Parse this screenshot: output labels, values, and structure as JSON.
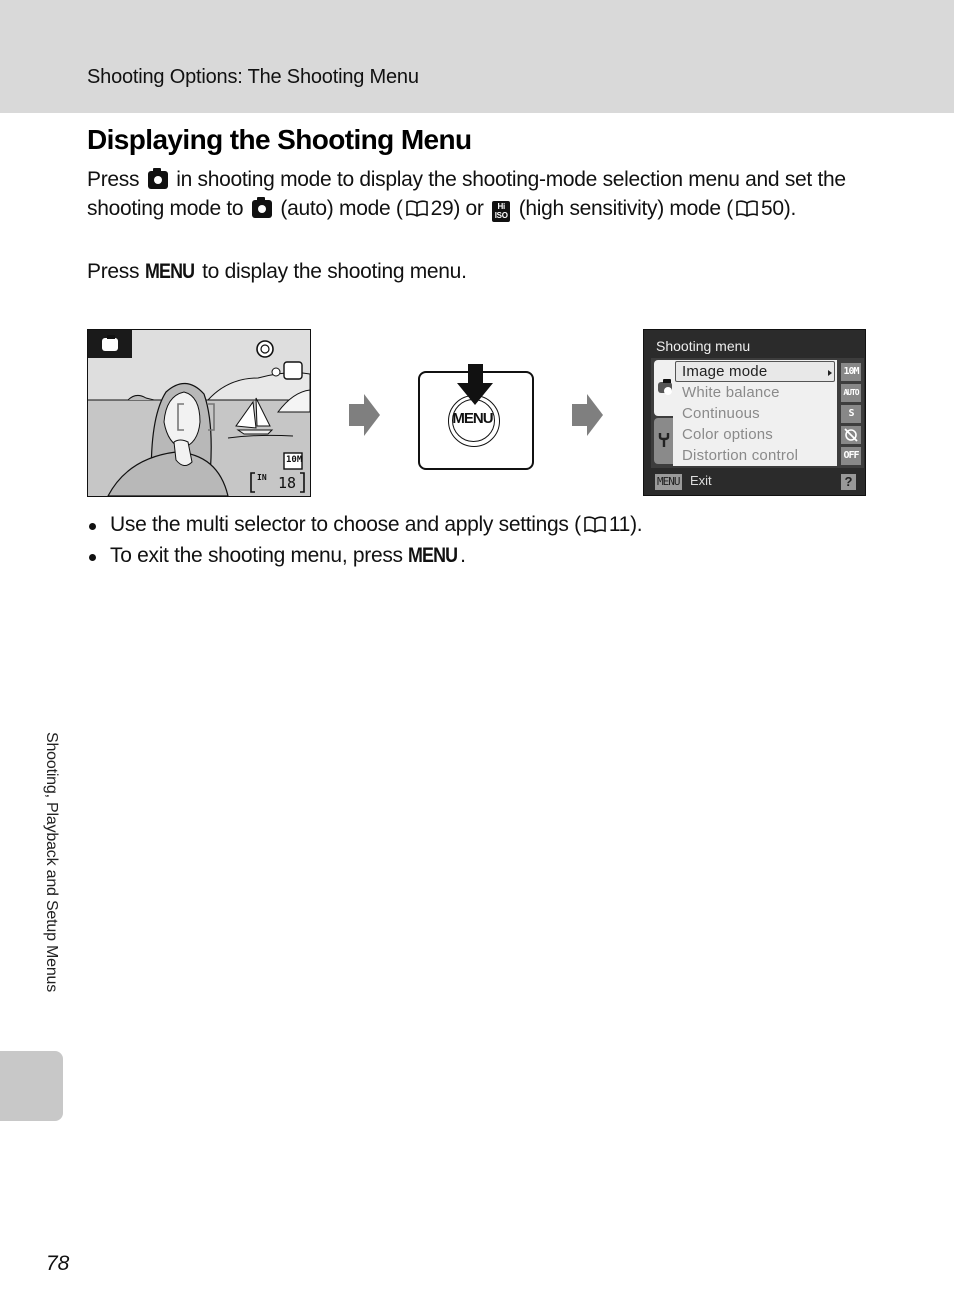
{
  "header": {
    "running_head": "Shooting Options: The Shooting Menu"
  },
  "title": "Displaying the Shooting Menu",
  "paragraph1": {
    "part1": "Press",
    "part2": "in shooting mode to display the shooting-mode selection menu and set the shooting mode to",
    "part3": "(auto) mode (",
    "ref1": "29",
    "part4": ") or",
    "part5": "(high sensitivity) mode (",
    "ref2": "50",
    "part6": ")."
  },
  "paragraph2": {
    "part1": "Press",
    "menu_word": "MENU",
    "part2": "to display the shooting menu."
  },
  "icons": {
    "shooting_mode_button": "camera-icon",
    "auto_mode": "camera-icon",
    "high_sensitivity": "hi-iso-icon",
    "page_reference": "book-icon"
  },
  "illustration": {
    "viewfinder": {
      "mode_icon": "camera-icon",
      "vr_icon": "vibration-reduction-icon",
      "image_size": "10M",
      "memory": "IN",
      "exposures_remaining": "18"
    },
    "button": {
      "label": "MENU"
    },
    "menu_screen": {
      "title": "Shooting menu",
      "items": [
        {
          "label": "Image mode",
          "value": "10M",
          "selected": true
        },
        {
          "label": "White balance",
          "value": "AUTO",
          "selected": false
        },
        {
          "label": "Continuous",
          "value": "S",
          "selected": false
        },
        {
          "label": "Color options",
          "value": "color-off",
          "selected": false
        },
        {
          "label": "Distortion control",
          "value": "OFF",
          "selected": false
        }
      ],
      "footer_menu": "MENU",
      "footer_exit": "Exit",
      "footer_help": "?"
    }
  },
  "bullets": [
    {
      "text": "Use the multi selector to choose and apply settings (",
      "ref": "11",
      "end": ")."
    },
    {
      "text": "To exit the shooting menu, press",
      "menu_word": "MENU",
      "end": "."
    }
  ],
  "side_tab": {
    "label": "Shooting, Playback and Setup Menus"
  },
  "page_number": "78"
}
